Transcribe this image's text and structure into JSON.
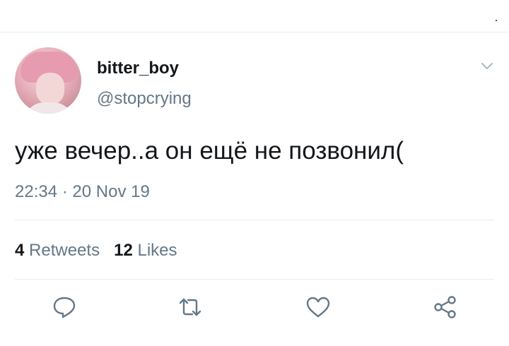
{
  "tweet": {
    "author": {
      "display_name": "bitter_boy",
      "handle": "@stopcrying"
    },
    "text": "уже вечер..а он ещё не позвонил(",
    "time": "22:34",
    "separator": "·",
    "date": "20 Nov 19",
    "stats": {
      "retweets_count": "4",
      "retweets_label": "Retweets",
      "likes_count": "12",
      "likes_label": "Likes"
    }
  },
  "icons": {
    "menu": "chevron-down-icon",
    "actions": [
      "reply-icon",
      "retweet-icon",
      "like-icon",
      "share-icon"
    ]
  },
  "colors": {
    "text_primary": "#14171a",
    "text_secondary": "#657786",
    "divider": "#e6ecf0",
    "icon": "#657786"
  }
}
